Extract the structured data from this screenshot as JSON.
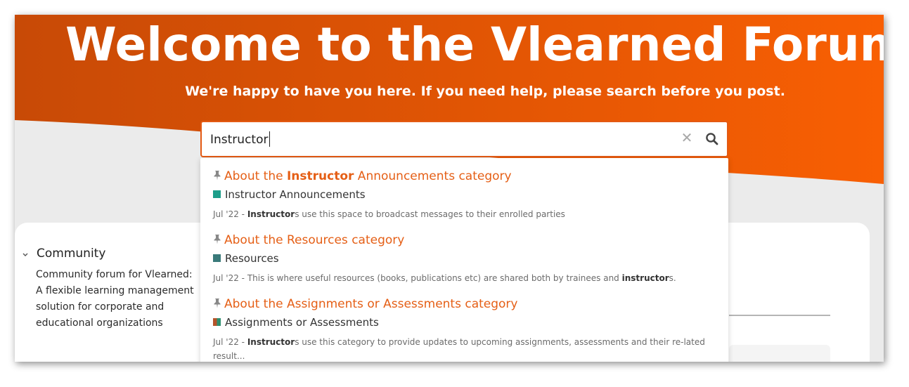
{
  "hero": {
    "title": "Welcome to the Vlearned Forum",
    "subtitle": "We're happy to have you here. If you need help, please search before you post.",
    "gradient_start": "#c84a06",
    "gradient_end": "#f85f03"
  },
  "search": {
    "value": "Instructor",
    "clear_icon": "close-icon",
    "search_icon": "search-icon"
  },
  "results": [
    {
      "title_pre": "About the ",
      "title_bold": "Instructor",
      "title_post": " Announcements category",
      "category": "Instructor Announcements",
      "category_color": "#1d9e8a",
      "excerpt_pre": "Jul '22 - ",
      "excerpt_bold": "Instructor",
      "excerpt_post": "s use this space to broadcast messages to their enrolled parties"
    },
    {
      "title_pre": "About the Resources category",
      "title_bold": "",
      "title_post": "",
      "category": "Resources",
      "category_color": "#3a7a7a",
      "excerpt_pre": "Jul '22 - This is where useful resources (books, publications etc) are shared both by trainees and ",
      "excerpt_bold": "instructor",
      "excerpt_post": "s."
    },
    {
      "title_pre": "About the Assignments or Assessments category",
      "title_bold": "",
      "title_post": "",
      "category": "Assignments or Assessments",
      "category_color": "#b5542a",
      "excerpt_pre": "Jul '22 - ",
      "excerpt_bold": "Instructor",
      "excerpt_post": "s use this category to provide updates to upcoming assignments, assessments and their re-lated result..."
    }
  ],
  "sidebar": {
    "community_heading": "Community",
    "community_description": "Community forum for Vlearned: A flexible learning management solution for corporate and educational organizations"
  }
}
